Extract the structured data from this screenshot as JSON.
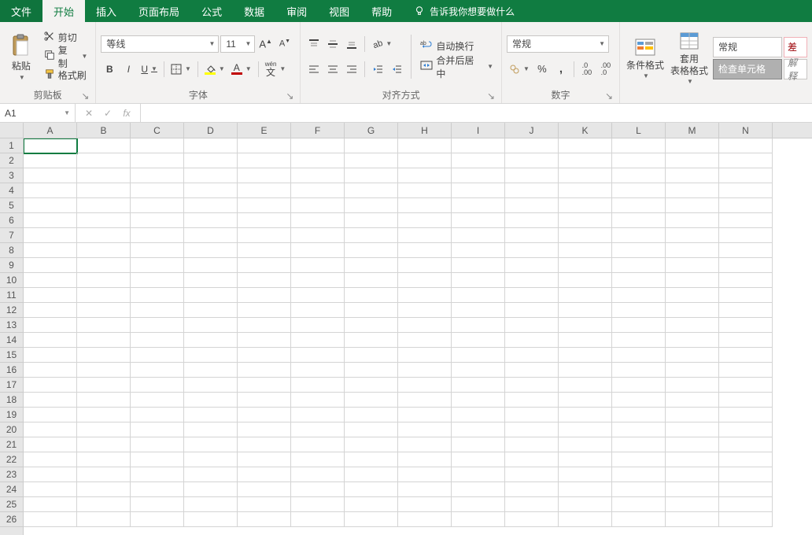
{
  "menubar": {
    "tabs": [
      "文件",
      "开始",
      "插入",
      "页面布局",
      "公式",
      "数据",
      "审阅",
      "视图",
      "帮助"
    ],
    "active_index": 1,
    "tell_me": "告诉我你想要做什么"
  },
  "ribbon": {
    "clipboard": {
      "paste": "粘贴",
      "cut": "剪切",
      "copy": "复制",
      "format_painter": "格式刷",
      "label": "剪贴板"
    },
    "font": {
      "family": "等线",
      "size": "11",
      "label": "字体",
      "phonetic": "wén"
    },
    "align": {
      "wrap": "自动换行",
      "merge": "合并后居中",
      "label": "对齐方式"
    },
    "number": {
      "format": "常规",
      "label": "数字"
    },
    "styles": {
      "cond": "条件格式",
      "table": "套用\n表格格式",
      "swatch1": "常规",
      "swatch2": "差",
      "swatch_sel": "检查单元格",
      "swatch_more": "解释"
    }
  },
  "formula_bar": {
    "name": "A1",
    "fx": "fx",
    "value": ""
  },
  "grid": {
    "columns": [
      "A",
      "B",
      "C",
      "D",
      "E",
      "F",
      "G",
      "H",
      "I",
      "J",
      "K",
      "L",
      "M",
      "N"
    ],
    "rows": 26,
    "active": "A1"
  }
}
